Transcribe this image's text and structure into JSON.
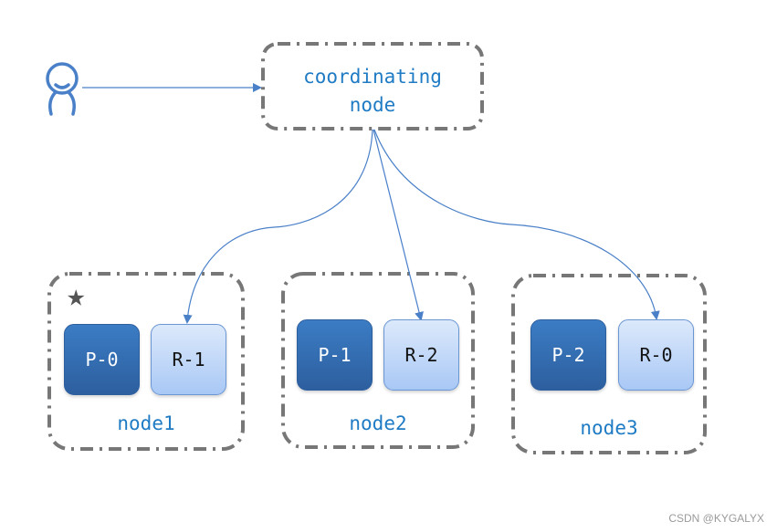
{
  "diagram": {
    "client": {
      "icon": "user-icon"
    },
    "coordinator": {
      "line1": "coordinating",
      "line2": "node"
    },
    "nodes": [
      {
        "name": "node1",
        "is_master": true,
        "shards": [
          {
            "label": "P-0",
            "kind": "primary"
          },
          {
            "label": "R-1",
            "kind": "replica"
          }
        ]
      },
      {
        "name": "node2",
        "is_master": false,
        "shards": [
          {
            "label": "P-1",
            "kind": "primary"
          },
          {
            "label": "R-2",
            "kind": "replica"
          }
        ]
      },
      {
        "name": "node3",
        "is_master": false,
        "shards": [
          {
            "label": "P-2",
            "kind": "primary"
          },
          {
            "label": "R-0",
            "kind": "replica"
          }
        ]
      }
    ],
    "master_marker": "★",
    "edges": [
      {
        "from": "client",
        "to": "coordinator"
      },
      {
        "from": "coordinator",
        "to": "node1.R-1"
      },
      {
        "from": "coordinator",
        "to": "node2.R-2"
      },
      {
        "from": "coordinator",
        "to": "node3.R-0"
      }
    ],
    "colors": {
      "accent": "#1f7bc4",
      "line": "#4a80c8",
      "dash": "#777777",
      "primary": "#2d5f9f",
      "replica": "#c4dbf8"
    }
  },
  "watermark": "CSDN @KYGALYX"
}
